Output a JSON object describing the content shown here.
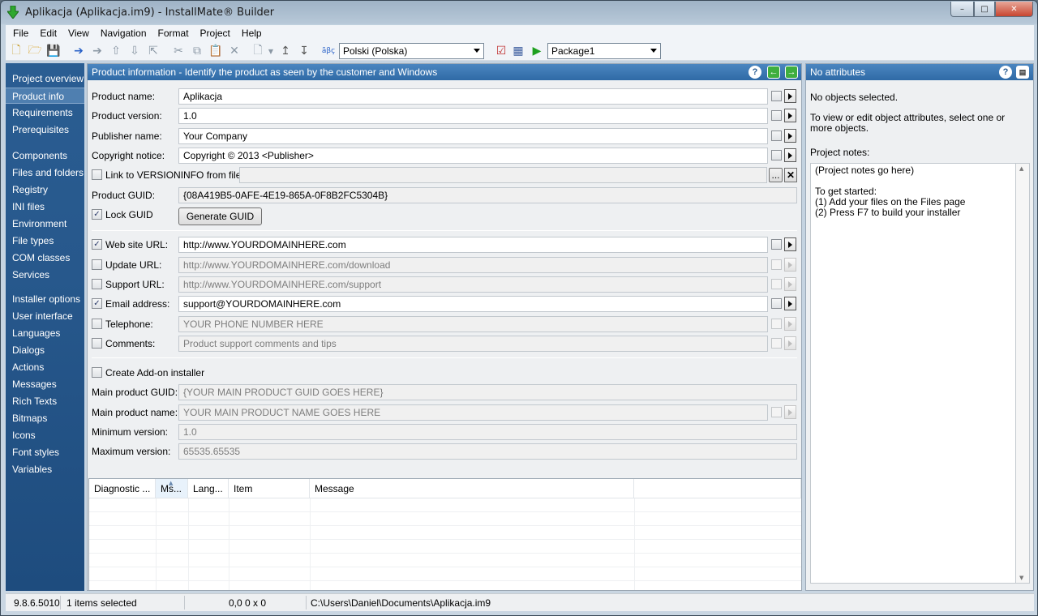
{
  "window": {
    "title": "Aplikacja (Aplikacja.im9) - InstallMate® Builder",
    "minimize": "–",
    "maximize": "□",
    "close": "✕"
  },
  "menu": [
    "File",
    "Edit",
    "View",
    "Navigation",
    "Format",
    "Project",
    "Help"
  ],
  "toolbar": {
    "language": "Polski (Polska)",
    "package": "Package1",
    "spell_icon": "ãβç"
  },
  "sidebar": {
    "groups": [
      [
        "Project overview",
        "Product info",
        "Requirements",
        "Prerequisites"
      ],
      [
        "Components",
        "Files and folders",
        "Registry",
        "INI files",
        "Environment",
        "File types",
        "COM classes",
        "Services"
      ],
      [
        "Installer options",
        "User interface",
        "Languages",
        "Dialogs",
        "Actions",
        "Messages",
        "Rich Texts",
        "Bitmaps",
        "Icons",
        "Font styles",
        "Variables"
      ]
    ],
    "selected": "Product info"
  },
  "panel": {
    "header": "Product information - Identify the product as seen by the customer and Windows",
    "help": "?"
  },
  "form": {
    "product_name": {
      "label": "Product name:",
      "value": "Aplikacja"
    },
    "product_version": {
      "label": "Product version:",
      "value": "1.0"
    },
    "publisher_name": {
      "label": "Publisher name:",
      "value": "Your Company"
    },
    "copyright": {
      "label": "Copyright notice:",
      "value": "Copyright © 2013 <Publisher>"
    },
    "versioninfo": {
      "label": "Link to VERSIONINFO from file:",
      "value": "",
      "browse": "...",
      "clear": "✕"
    },
    "product_guid": {
      "label": "Product GUID:",
      "value": "{08A419B5-0AFE-4E19-865A-0F8B2FC5304B}"
    },
    "lock_guid": {
      "label": "Lock GUID",
      "checked": true
    },
    "generate_guid": "Generate GUID",
    "website": {
      "label": "Web site URL:",
      "value": "http://www.YOURDOMAINHERE.com",
      "checked": true
    },
    "update": {
      "label": "Update URL:",
      "value": "http://www.YOURDOMAINHERE.com/download",
      "checked": false
    },
    "support": {
      "label": "Support URL:",
      "value": "http://www.YOURDOMAINHERE.com/support",
      "checked": false
    },
    "email": {
      "label": "Email address:",
      "value": "support@YOURDOMAINHERE.com",
      "checked": true
    },
    "telephone": {
      "label": "Telephone:",
      "value": "YOUR PHONE NUMBER HERE",
      "checked": false
    },
    "comments": {
      "label": "Comments:",
      "value": "Product support comments and tips",
      "checked": false
    },
    "addon": {
      "label": "Create Add-on installer",
      "checked": false
    },
    "main_guid": {
      "label": "Main product GUID:",
      "value": "{YOUR MAIN PRODUCT GUID GOES HERE}"
    },
    "main_name": {
      "label": "Main product name:",
      "value": "YOUR MAIN PRODUCT NAME GOES HERE"
    },
    "min_version": {
      "label": "Minimum version:",
      "value": "1.0"
    },
    "max_version": {
      "label": "Maximum version:",
      "value": "65535.65535"
    }
  },
  "diagnostics": {
    "columns": [
      "Diagnostic ...",
      "Ms...",
      "Lang...",
      "Item",
      "Message"
    ]
  },
  "attributes": {
    "header": "No attributes",
    "help": "?",
    "no_objects": "No objects selected.",
    "hint": "To view or edit object attributes, select one or more objects.",
    "notes_label": "Project notes:",
    "notes": "(Project notes go here)\n\nTo get started:\n(1) Add your files on the Files page\n(2) Press F7 to build your installer"
  },
  "status": {
    "version": "9.8.6.5010",
    "selection": "1 items selected",
    "position": "0,0  0 x 0",
    "path": "C:\\Users\\Daniel\\Documents\\Aplikacja.im9"
  }
}
